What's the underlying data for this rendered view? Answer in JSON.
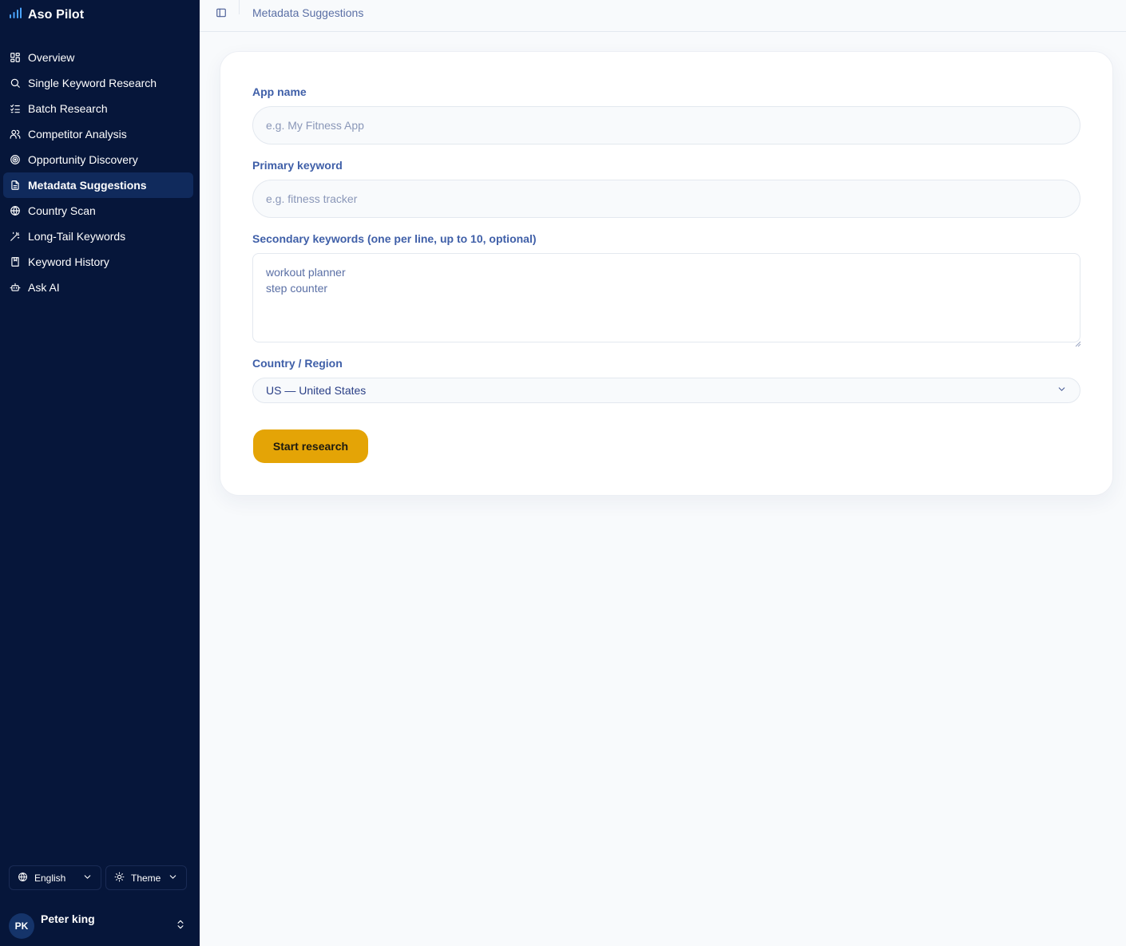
{
  "app": {
    "title": "Aso Pilot"
  },
  "colors": {
    "sidebar_bg": "#06163a",
    "accent": "#e4a406",
    "label": "#3f5fa8"
  },
  "sidebar": {
    "items": [
      {
        "label": "Overview",
        "icon": "layout-dashboard-icon"
      },
      {
        "label": "Single Keyword Research",
        "icon": "search-icon"
      },
      {
        "label": "Batch Research",
        "icon": "list-checks-icon"
      },
      {
        "label": "Competitor Analysis",
        "icon": "users-icon"
      },
      {
        "label": "Opportunity Discovery",
        "icon": "target-icon"
      },
      {
        "label": "Metadata Suggestions",
        "icon": "file-text-icon",
        "active": true
      },
      {
        "label": "Country Scan",
        "icon": "globe-icon"
      },
      {
        "label": "Long-Tail Keywords",
        "icon": "wand-icon"
      },
      {
        "label": "Keyword History",
        "icon": "book-bookmark-icon"
      },
      {
        "label": "Ask AI",
        "icon": "bot-icon"
      }
    ],
    "language": "English",
    "theme": "Theme",
    "user": {
      "initials": "PK",
      "name": "Peter king"
    }
  },
  "header": {
    "breadcrumb": "Metadata Suggestions"
  },
  "form": {
    "app_name": {
      "label": "App name",
      "placeholder": "e.g. My Fitness App"
    },
    "primary_keyword": {
      "label": "Primary keyword",
      "placeholder": "e.g. fitness tracker"
    },
    "secondary_keywords": {
      "label": "Secondary keywords (one per line, up to 10, optional)",
      "placeholder": "workout planner\nstep counter"
    },
    "country": {
      "label": "Country / Region",
      "value": "US — United States"
    },
    "submit": "Start research"
  }
}
